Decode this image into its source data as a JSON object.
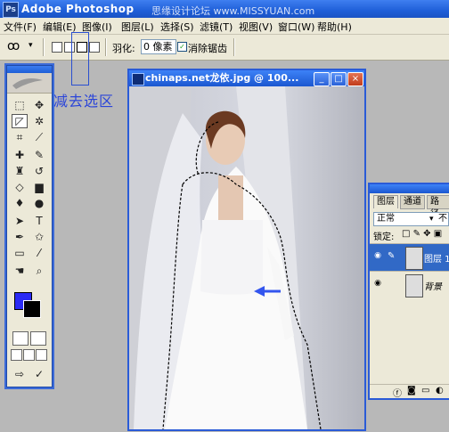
{
  "app": {
    "title": "Adobe Photoshop",
    "icon_label": "Ps",
    "watermark": "思缘设计论坛 www.MISSYUAN.com"
  },
  "menu": [
    {
      "label": "文件(F)"
    },
    {
      "label": "编辑(E)"
    },
    {
      "label": "图像(I)"
    },
    {
      "label": "图层(L)"
    },
    {
      "label": "选择(S)"
    },
    {
      "label": "滤镜(T)"
    },
    {
      "label": "视图(V)"
    },
    {
      "label": "窗口(W)"
    },
    {
      "label": "帮助(H)"
    }
  ],
  "options": {
    "feather_label": "羽化:",
    "feather_value": "0 像素",
    "antialias_label": "消除锯齿",
    "antialias_checked": "✓"
  },
  "annotation": {
    "text": "减去选区"
  },
  "document": {
    "title": "chinaps.net龙依.jpg @ 100...",
    "min": "_",
    "max": "□",
    "close": "×"
  },
  "layers_panel": {
    "tabs": [
      "图层",
      "通道",
      "路径"
    ],
    "blend_mode": "正常",
    "opacity_prefix": "不",
    "lock_label": "锁定:",
    "layers": [
      {
        "name": "图层 1"
      },
      {
        "name": "背景"
      }
    ]
  },
  "colors": {
    "foreground": "#2a2af5",
    "background": "#000000",
    "accent": "#2a5bd7"
  }
}
